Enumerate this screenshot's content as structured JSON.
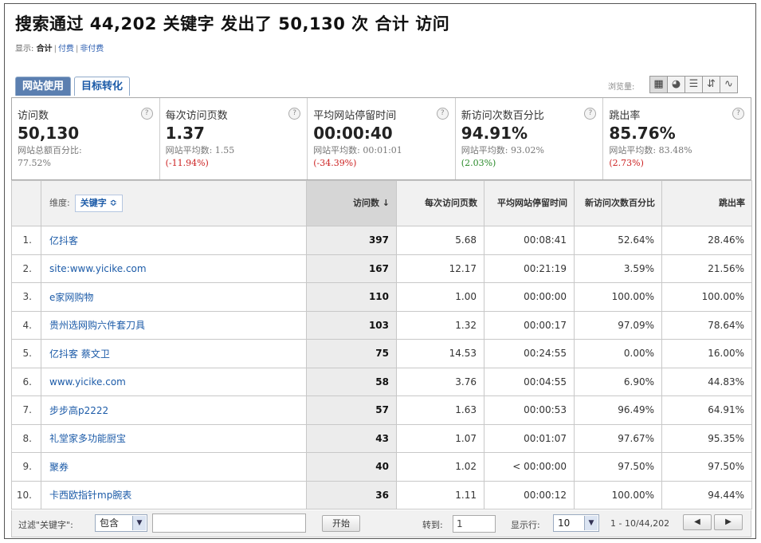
{
  "title": "搜索通过 44,202 关键字 发出了 50,130 次 合计 访问",
  "show": {
    "label": "显示:",
    "options": [
      "合计",
      "付费",
      "非付费"
    ]
  },
  "tabs": [
    {
      "label": "网站使用",
      "active": true
    },
    {
      "label": "目标转化",
      "active": false
    }
  ],
  "views": {
    "label": "浏览量:",
    "buttons": [
      {
        "icon": "table-view-icon",
        "glyph": "▦",
        "active": true
      },
      {
        "icon": "pie-view-icon",
        "glyph": "◕",
        "active": false
      },
      {
        "icon": "performance-view-icon",
        "glyph": "☰",
        "active": false
      },
      {
        "icon": "comparison-view-icon",
        "glyph": "⇵",
        "active": false
      },
      {
        "icon": "pivot-view-icon",
        "glyph": "∿",
        "active": false
      }
    ]
  },
  "metrics": [
    {
      "label": "访问数",
      "help": "?",
      "value": "50,130",
      "sub": "网站总额百分比:",
      "sub2": "77.52%",
      "change": "",
      "change_type": ""
    },
    {
      "label": "每次访问页数",
      "help": "?",
      "value": "1.37",
      "sub": "网站平均数: 1.55",
      "sub2": "",
      "change": "(-11.94%)",
      "change_type": "neg"
    },
    {
      "label": "平均网站停留时间",
      "help": "?",
      "value": "00:00:40",
      "sub": "网站平均数: 00:01:01",
      "sub2": "",
      "change": "(-34.39%)",
      "change_type": "neg"
    },
    {
      "label": "新访问次数百分比",
      "help": "?",
      "value": "94.91%",
      "sub": "网站平均数: 93.02%",
      "sub2": "",
      "change": "(2.03%)",
      "change_type": "pos"
    },
    {
      "label": "跳出率",
      "help": "?",
      "value": "85.76%",
      "sub": "网站平均数: 83.48%",
      "sub2": "",
      "change": "(2.73%)",
      "change_type": "neg"
    }
  ],
  "table": {
    "dimension_label": "维度:",
    "dimension_value": "关键字",
    "dimension_arrow": "≎",
    "columns": [
      {
        "label": "访问数 ↓",
        "sorted": true
      },
      {
        "label": "每次访问页数",
        "sorted": false
      },
      {
        "label": "平均网站停留时间",
        "sorted": false
      },
      {
        "label": "新访问次数百分比",
        "sorted": false
      },
      {
        "label": "跳出率",
        "sorted": false
      }
    ],
    "rows": [
      {
        "index": "1.",
        "keyword": "亿抖客",
        "visits": "397",
        "pages": "5.68",
        "time": "00:08:41",
        "new_pct": "52.64%",
        "bounce": "28.46%"
      },
      {
        "index": "2.",
        "keyword": "site:www.yicike.com",
        "visits": "167",
        "pages": "12.17",
        "time": "00:21:19",
        "new_pct": "3.59%",
        "bounce": "21.56%"
      },
      {
        "index": "3.",
        "keyword": "e家网购物",
        "visits": "110",
        "pages": "1.00",
        "time": "00:00:00",
        "new_pct": "100.00%",
        "bounce": "100.00%"
      },
      {
        "index": "4.",
        "keyword": "贵州选网购六件套刀具",
        "visits": "103",
        "pages": "1.32",
        "time": "00:00:17",
        "new_pct": "97.09%",
        "bounce": "78.64%"
      },
      {
        "index": "5.",
        "keyword": "亿抖客 蔡文卫",
        "visits": "75",
        "pages": "14.53",
        "time": "00:24:55",
        "new_pct": "0.00%",
        "bounce": "16.00%"
      },
      {
        "index": "6.",
        "keyword": "www.yicike.com",
        "visits": "58",
        "pages": "3.76",
        "time": "00:04:55",
        "new_pct": "6.90%",
        "bounce": "44.83%"
      },
      {
        "index": "7.",
        "keyword": "步步高p2222",
        "visits": "57",
        "pages": "1.63",
        "time": "00:00:53",
        "new_pct": "96.49%",
        "bounce": "64.91%"
      },
      {
        "index": "8.",
        "keyword": "礼堂家多功能厨宝",
        "visits": "43",
        "pages": "1.07",
        "time": "00:01:07",
        "new_pct": "97.67%",
        "bounce": "95.35%"
      },
      {
        "index": "9.",
        "keyword": "聚券",
        "visits": "40",
        "pages": "1.02",
        "time": "< 00:00:00",
        "new_pct": "97.50%",
        "bounce": "97.50%"
      },
      {
        "index": "10.",
        "keyword": "卡西欧指针mp腕表",
        "visits": "36",
        "pages": "1.11",
        "time": "00:00:12",
        "new_pct": "100.00%",
        "bounce": "94.44%"
      }
    ]
  },
  "footer": {
    "filter_label": "过滤\"关键字\":",
    "filter_select": "包含",
    "filter_input": "",
    "go_button": "开始",
    "goto_label": "转到:",
    "goto_value": "1",
    "rows_label": "显示行:",
    "rows_value": "10",
    "range": "1 - 10/44,202",
    "prev": "◀",
    "next": "▶"
  }
}
